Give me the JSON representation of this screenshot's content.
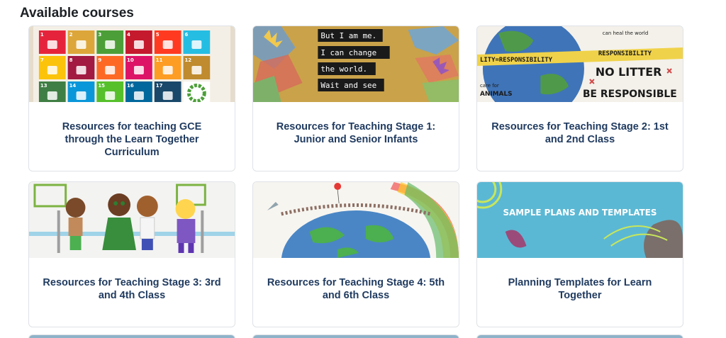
{
  "section": {
    "title": "Available courses"
  },
  "courses": [
    {
      "title": "Resources for teaching GCE through the Learn Together Curriculum",
      "image": "sdg-goals-grid"
    },
    {
      "title": "Resources for Teaching Stage 1: Junior and Senior Infants",
      "image": "children-handprints-poster"
    },
    {
      "title": "Resources for Teaching Stage 2: 1st and 2nd Class",
      "image": "earth-responsibility-drawing"
    },
    {
      "title": "Resources for Teaching Stage 3: 3rd and 4th Class",
      "image": "children-drawing"
    },
    {
      "title": "Resources for Teaching Stage 4: 5th and 6th Class",
      "image": "world-holding-hands-drawing"
    },
    {
      "title": "Planning Templates for Learn Together",
      "image": "sample-plans-banner",
      "banner_text": "SAMPLE PLANS AND TEMPLATES"
    }
  ],
  "sdg_numbers": [
    "1",
    "2",
    "3",
    "4",
    "5",
    "6",
    "7",
    "8",
    "9",
    "10",
    "11",
    "12",
    "13",
    "14",
    "15",
    "16",
    "17"
  ],
  "poster_lines": [
    "But I am me.",
    "I can change",
    "the world.",
    "Wait and see"
  ],
  "drawing_words": {
    "banner": "LITY=RESPONSIBILITY",
    "banner2": "RESPONSIBILITY",
    "care": "care for",
    "animals": "ANIMALS",
    "no_litter": "NO LITTER",
    "be_resp": "BE RESPONSIBLE",
    "heal": "can heal the world"
  },
  "colors": {
    "title": "#1f3a5f",
    "border": "#dee2e6",
    "banner_bg": "#5bb8d4"
  }
}
